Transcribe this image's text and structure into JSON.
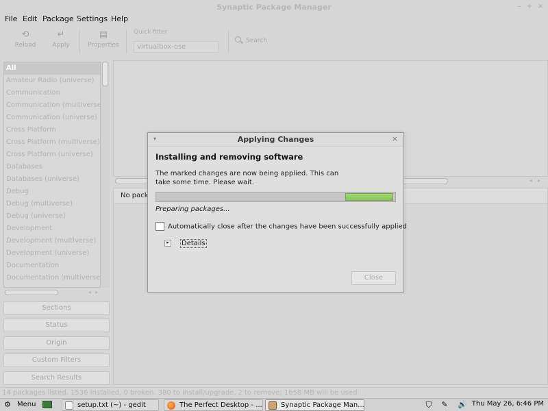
{
  "window": {
    "title": "Synaptic Package Manager"
  },
  "menubar": {
    "items": [
      "File",
      "Edit",
      "Package",
      "Settings",
      "Help"
    ]
  },
  "toolbar": {
    "reload": "Reload",
    "apply": "Apply",
    "properties": "Properties",
    "quick_filter_label": "Quick filter",
    "quick_filter_value": "virtualbox-ose",
    "search": "Search"
  },
  "sections": {
    "items": [
      "All",
      "Amateur Radio (universe)",
      "Communication",
      "Communication (multiverse)",
      "Communication (universe)",
      "Cross Platform",
      "Cross Platform (multiverse)",
      "Cross Platform (universe)",
      "Databases",
      "Databases (universe)",
      "Debug",
      "Debug (multiverse)",
      "Debug (universe)",
      "Development",
      "Development (multiverse)",
      "Development (universe)",
      "Documentation",
      "Documentation (multiverse)"
    ],
    "selected_index": 0
  },
  "filter_buttons": {
    "sections": "Sections",
    "status": "Status",
    "origin": "Origin",
    "custom_filters": "Custom Filters",
    "search_results": "Search Results"
  },
  "description": {
    "text": "No pack"
  },
  "statusbar": {
    "text": "14 packages listed, 1536 installed, 0 broken. 380 to install/upgrade, 2 to remove; 1658 MB will be used"
  },
  "dialog": {
    "title": "Applying Changes",
    "heading": "Installing and removing software",
    "message": "The marked changes are now being applied. This can take some time. Please wait.",
    "progress_fraction": 0.2,
    "status": "Preparing packages...",
    "auto_close_label": "Automatically close after the changes have been successfully applied",
    "auto_close_checked": false,
    "details_label": "Details",
    "close_button": "Close",
    "progress_color": "#8ec65f"
  },
  "taskbar": {
    "menu": "Menu",
    "windows": [
      "setup.txt (~) - gedit",
      "The Perfect Desktop - ...",
      "Synaptic Package Man..."
    ],
    "clock": "Thu May 26,  6:46 PM"
  }
}
